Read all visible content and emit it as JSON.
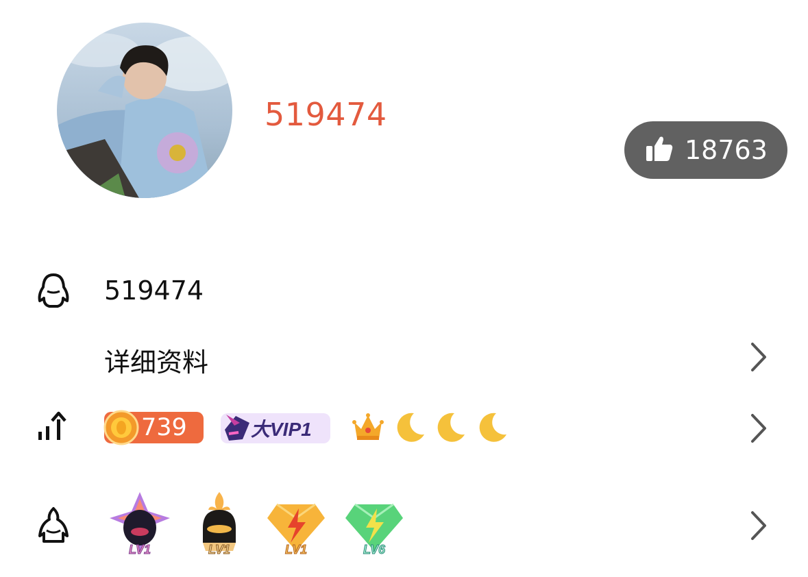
{
  "profile": {
    "nickname": "519474",
    "likes_count": "18763"
  },
  "rows": {
    "qq_number": "519474",
    "detail_label": "详细资料"
  },
  "level": {
    "coin_value": "739",
    "vip_label": "大VIP1",
    "icons": [
      "crown-icon",
      "moon-icon",
      "moon-icon",
      "moon-icon"
    ]
  },
  "badges": [
    {
      "name": "purple-penguin-badge",
      "label": "LV1"
    },
    {
      "name": "fire-penguin-badge",
      "label": "LV1"
    },
    {
      "name": "lightning-diamond-badge",
      "label": "LV1"
    },
    {
      "name": "green-diamond-badge",
      "label": "LV6"
    }
  ],
  "colors": {
    "nickname": "#e35a3e",
    "like_pill": "#616161",
    "coin_badge": "#ee6a3e",
    "vip_badge_bg": "#efe3fb",
    "moon": "#f5c13b"
  }
}
